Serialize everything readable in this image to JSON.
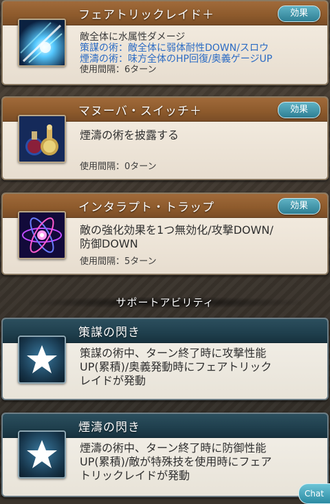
{
  "skills": [
    {
      "title": "フェアトリックレイド＋",
      "effect_label": "効果",
      "desc_lines": [
        {
          "text": "敵全体に水属性ダメージ",
          "style": "normal"
        },
        {
          "text": "策謀の術：敵全体に弱体耐性DOWN/スロウ",
          "style": "blue"
        },
        {
          "text": "煙濤の術：味方全体のHP回復/奥義ゲージUP",
          "style": "blue"
        }
      ],
      "cooldown": "使用間隔：6ターン",
      "icon": "water-strike-icon"
    },
    {
      "title": "マヌーバ・スイッチ＋",
      "effect_label": "効果",
      "desc": "煙濤の術を披露する",
      "cooldown": "使用間隔：0ターン",
      "icon": "potion-flasks-icon"
    },
    {
      "title": "インタラプト・トラップ",
      "effect_label": "効果",
      "desc_lines": [
        "敵の強化効果を1つ無効化/攻撃DOWN/",
        "防御DOWN"
      ],
      "cooldown": "使用間隔：5ターン",
      "icon": "atom-trap-icon"
    }
  ],
  "support_header": "サポートアビリティ",
  "supports": [
    {
      "title": "策謀の閃き",
      "desc_lines": [
        "策謀の術中、ターン終了時に攻撃性能",
        "UP(累積)/奥義発動時にフェアトリック",
        "レイドが発動"
      ],
      "icon": "star-icon"
    },
    {
      "title": "煙濤の閃き",
      "desc_lines": [
        "煙濤の術中、ターン終了時に防御性能",
        "UP(累積)/敵が特殊技を使用時にフェア",
        "トリックレイドが発動"
      ],
      "icon": "star-icon"
    }
  ],
  "chat_label": "Chat"
}
